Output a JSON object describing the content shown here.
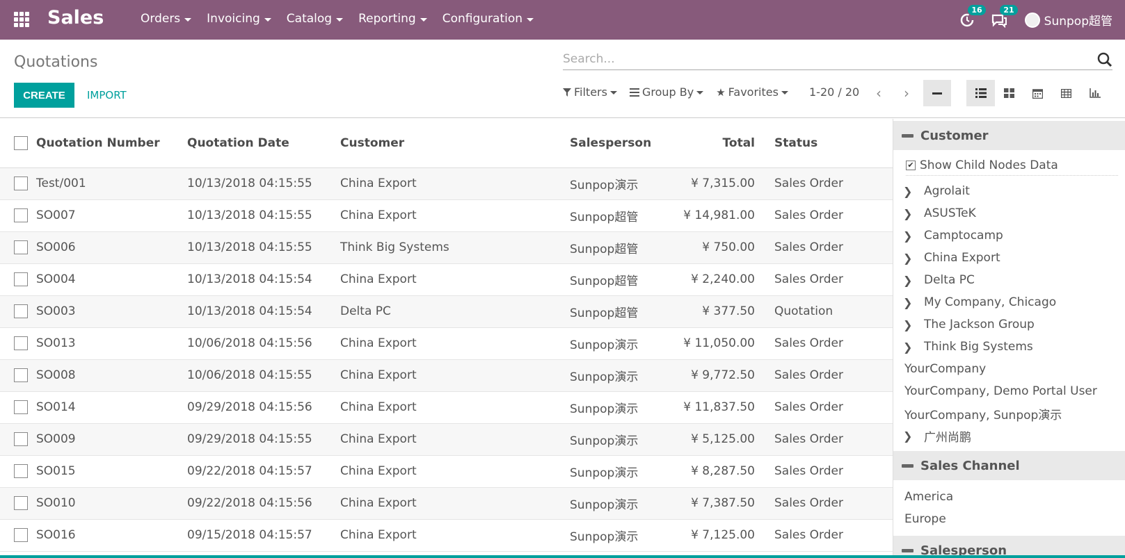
{
  "navbar": {
    "brand": "Sales",
    "menu": [
      "Orders",
      "Invoicing",
      "Catalog",
      "Reporting",
      "Configuration"
    ],
    "activity_count": "16",
    "messages_count": "21",
    "user": "Sunpop超管"
  },
  "control_panel": {
    "title": "Quotations",
    "create_label": "CREATE",
    "import_label": "IMPORT",
    "search_placeholder": "Search...",
    "filters_label": "Filters",
    "groupby_label": "Group By",
    "favorites_label": "Favorites",
    "pager": "1-20 / 20"
  },
  "table": {
    "headers": [
      "Quotation Number",
      "Quotation Date",
      "Customer",
      "Salesperson",
      "Total",
      "Status"
    ],
    "rows": [
      [
        "Test/001",
        "10/13/2018 04:15:55",
        "China Export",
        "Sunpop演示",
        "¥ 7,315.00",
        "Sales Order"
      ],
      [
        "SO007",
        "10/13/2018 04:15:55",
        "China Export",
        "Sunpop超管",
        "¥ 14,981.00",
        "Sales Order"
      ],
      [
        "SO006",
        "10/13/2018 04:15:55",
        "Think Big Systems",
        "Sunpop超管",
        "¥ 750.00",
        "Sales Order"
      ],
      [
        "SO004",
        "10/13/2018 04:15:54",
        "China Export",
        "Sunpop超管",
        "¥ 2,240.00",
        "Sales Order"
      ],
      [
        "SO003",
        "10/13/2018 04:15:54",
        "Delta PC",
        "Sunpop超管",
        "¥ 377.50",
        "Quotation"
      ],
      [
        "SO013",
        "10/06/2018 04:15:56",
        "China Export",
        "Sunpop演示",
        "¥ 11,050.00",
        "Sales Order"
      ],
      [
        "SO008",
        "10/06/2018 04:15:55",
        "China Export",
        "Sunpop演示",
        "¥ 9,772.50",
        "Sales Order"
      ],
      [
        "SO014",
        "09/29/2018 04:15:56",
        "China Export",
        "Sunpop演示",
        "¥ 11,837.50",
        "Sales Order"
      ],
      [
        "SO009",
        "09/29/2018 04:15:55",
        "China Export",
        "Sunpop演示",
        "¥ 5,125.00",
        "Sales Order"
      ],
      [
        "SO015",
        "09/22/2018 04:15:57",
        "China Export",
        "Sunpop演示",
        "¥ 8,287.50",
        "Sales Order"
      ],
      [
        "SO010",
        "09/22/2018 04:15:56",
        "China Export",
        "Sunpop演示",
        "¥ 7,387.50",
        "Sales Order"
      ],
      [
        "SO016",
        "09/15/2018 04:15:57",
        "China Export",
        "Sunpop演示",
        "¥ 7,125.00",
        "Sales Order"
      ]
    ]
  },
  "side_panel": {
    "customer_title": "Customer",
    "show_child_label": "Show Child Nodes Data",
    "customers": [
      {
        "label": "Agrolait",
        "expandable": true
      },
      {
        "label": "ASUSTeK",
        "expandable": true
      },
      {
        "label": "Camptocamp",
        "expandable": true
      },
      {
        "label": "China Export",
        "expandable": true
      },
      {
        "label": "Delta PC",
        "expandable": true
      },
      {
        "label": "My Company, Chicago",
        "expandable": true
      },
      {
        "label": "The Jackson Group",
        "expandable": true
      },
      {
        "label": "Think Big Systems",
        "expandable": true
      },
      {
        "label": "YourCompany",
        "expandable": false
      },
      {
        "label": "YourCompany, Demo Portal User",
        "expandable": false
      },
      {
        "label": "YourCompany, Sunpop演示",
        "expandable": false
      },
      {
        "label": "广州尚鹏",
        "expandable": true
      }
    ],
    "channel_title": "Sales Channel",
    "channels": [
      "America",
      "Europe"
    ],
    "salesperson_title": "Salesperson"
  }
}
